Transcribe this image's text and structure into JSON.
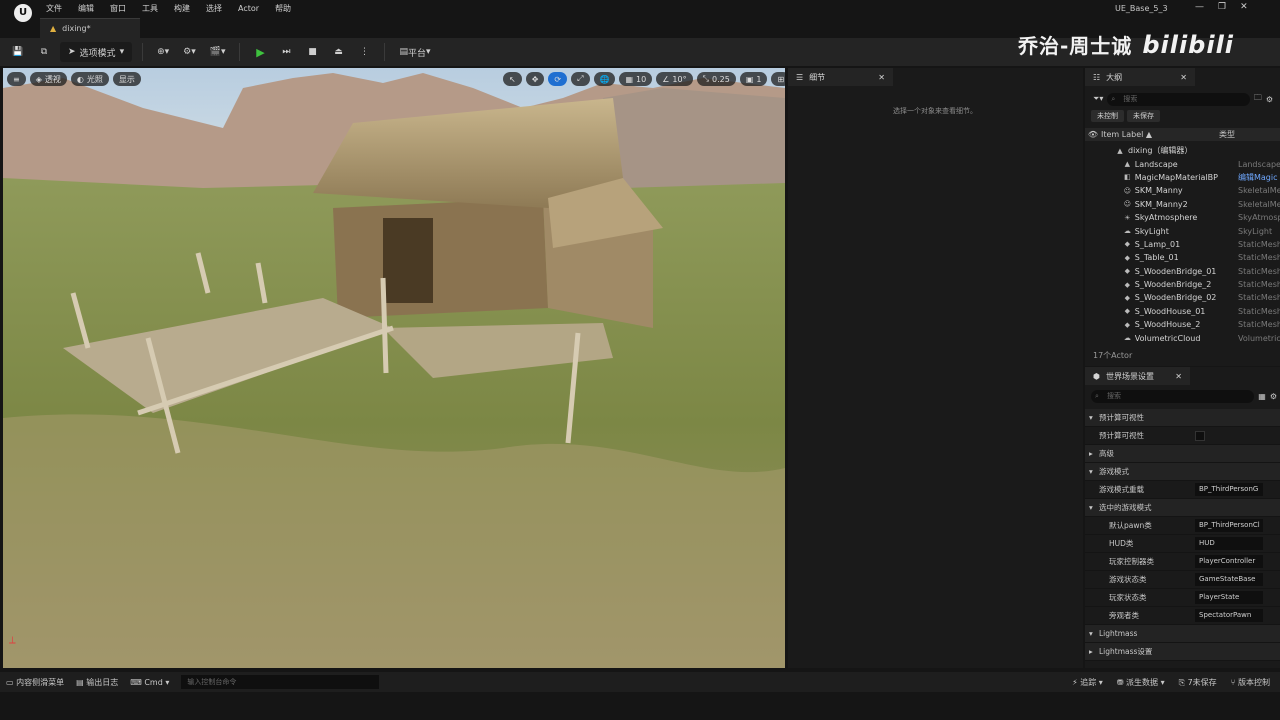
{
  "app": {
    "window_title": "UE_Base_5_3",
    "logo": "U",
    "doc_tab": "dixing*"
  },
  "menu": [
    "文件",
    "编辑",
    "窗口",
    "工具",
    "构建",
    "选择",
    "Actor",
    "帮助"
  ],
  "toolbar": {
    "mode_label": "选项模式",
    "platform_label": "平台"
  },
  "watermark": {
    "name": "乔治-周士诚",
    "brand": "bilibili"
  },
  "viewport": {
    "left_chips": [
      "透视",
      "光照",
      "显示"
    ],
    "grid_value": "10",
    "angle_value": "10°",
    "scale_value": "0.25",
    "camera_value": "1"
  },
  "details": {
    "tab": "细节",
    "empty_text": "选择一个对象来查看细节。"
  },
  "outliner": {
    "tab": "大纲",
    "search_placeholder": "搜索",
    "btn_uncontrolled": "未控制",
    "btn_unsaved": "未保存",
    "col_label": "Item Label ▲",
    "col_type": "类型",
    "root": "dixing（编辑器）",
    "rows": [
      {
        "name": "Landscape",
        "type": "Landscape",
        "icon": "landscape-icon"
      },
      {
        "name": "MagicMapMaterialBP",
        "type": "编辑Magic",
        "icon": "blueprint-icon"
      },
      {
        "name": "SKM_Manny",
        "type": "SkeletalMe",
        "icon": "skeletal-icon"
      },
      {
        "name": "SKM_Manny2",
        "type": "SkeletalMe",
        "icon": "skeletal-icon"
      },
      {
        "name": "SkyAtmosphere",
        "type": "SkyAtmosp",
        "icon": "sky-icon"
      },
      {
        "name": "SkyLight",
        "type": "SkyLight",
        "icon": "skylight-icon"
      },
      {
        "name": "S_Lamp_01",
        "type": "StaticMesh",
        "icon": "mesh-icon"
      },
      {
        "name": "S_Table_01",
        "type": "StaticMesh",
        "icon": "mesh-icon"
      },
      {
        "name": "S_WoodenBridge_01",
        "type": "StaticMesh",
        "icon": "mesh-icon"
      },
      {
        "name": "S_WoodenBridge_2",
        "type": "StaticMesh",
        "icon": "mesh-icon"
      },
      {
        "name": "S_WoodenBridge_02",
        "type": "StaticMesh",
        "icon": "mesh-icon"
      },
      {
        "name": "S_WoodHouse_01",
        "type": "StaticMesh",
        "icon": "mesh-icon"
      },
      {
        "name": "S_WoodHouse_2",
        "type": "StaticMesh",
        "icon": "mesh-icon"
      },
      {
        "name": "VolumetricCloud",
        "type": "Volumetric",
        "icon": "cloud-icon"
      }
    ],
    "count": "17个Actor"
  },
  "world": {
    "tab": "世界场景设置",
    "search_placeholder": "搜索",
    "rows": [
      {
        "kind": "cat",
        "label": "预计算可视性",
        "open": true
      },
      {
        "kind": "check",
        "label": "预计算可视性"
      },
      {
        "kind": "cat",
        "label": "高级",
        "open": false
      },
      {
        "kind": "cat",
        "label": "游戏模式",
        "open": true
      },
      {
        "kind": "val",
        "label": "游戏模式重载",
        "value": "BP_ThirdPersonG"
      },
      {
        "kind": "cat",
        "label": "选中的游戏模式",
        "open": true
      },
      {
        "kind": "val",
        "label": "默认pawn类",
        "value": "BP_ThirdPersonCl"
      },
      {
        "kind": "val",
        "label": "HUD类",
        "value": "HUD"
      },
      {
        "kind": "val",
        "label": "玩家控制器类",
        "value": "PlayerController"
      },
      {
        "kind": "val",
        "label": "游戏状态类",
        "value": "GameStateBase"
      },
      {
        "kind": "val",
        "label": "玩家状态类",
        "value": "PlayerState"
      },
      {
        "kind": "val",
        "label": "旁观者类",
        "value": "SpectatorPawn"
      },
      {
        "kind": "cat",
        "label": "Lightmass",
        "open": true
      },
      {
        "kind": "cat",
        "label": "Lightmass设置",
        "open": false
      }
    ]
  },
  "status": {
    "content_drawer": "内容侧滑菜单",
    "output_log": "输出日志",
    "cmd": "Cmd",
    "cmd_placeholder": "输入控制台命令",
    "trace": "追踪",
    "derived_data": "派生数据",
    "unsaved": "7未保存",
    "source_control": "版本控制"
  }
}
